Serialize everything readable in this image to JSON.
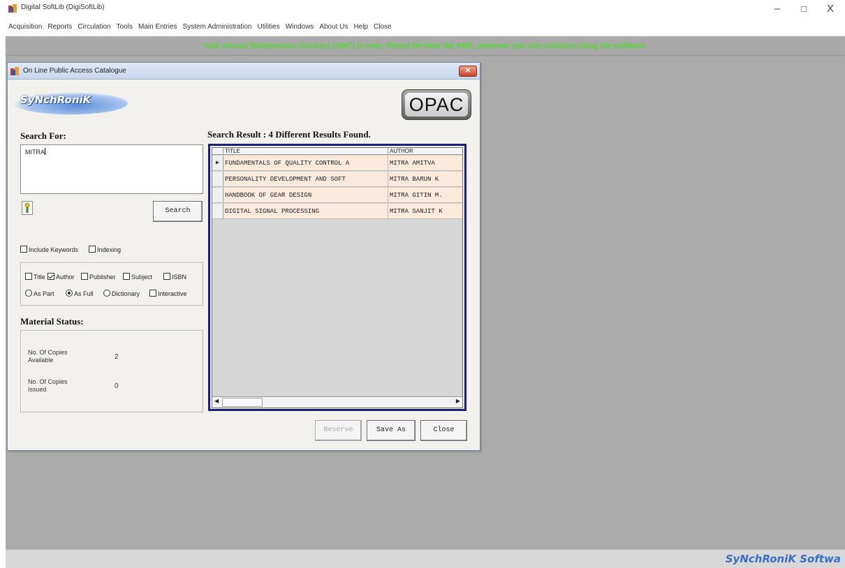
{
  "app": {
    "title": "Digital SoftLib (DigiSoftLib)",
    "window_controls": {
      "minimize": "–",
      "maximize": "□",
      "close": "X"
    }
  },
  "menu": [
    "Acquisition",
    "Reports",
    "Circulation",
    "Tools",
    "Main Entries",
    "System Administration",
    "Utilities",
    "Windows",
    "About Us",
    "Help",
    "Close"
  ],
  "notice": "Your Annual Maintenance Contract (AMC) is over. Please Re-New the AMC, However you can continue using the software.",
  "opac": {
    "window_title": "On Line Public Access Catalogue",
    "brand": "SyNchRoniK",
    "badge": "OPAC",
    "search_for_label": "Search For:",
    "search_value": "MITRA",
    "search_button": "Search",
    "include_keywords": "Include Keywords",
    "indexing": "Indexing",
    "fields": [
      {
        "label": "Title",
        "checked": false
      },
      {
        "label": "Author",
        "checked": true
      },
      {
        "label": "Publisher",
        "checked": false
      },
      {
        "label": "Subject",
        "checked": false
      },
      {
        "label": "ISBN",
        "checked": false
      }
    ],
    "match_modes": [
      {
        "label": "As Part",
        "selected": false
      },
      {
        "label": "As Full",
        "selected": true
      },
      {
        "label": "Dictionary",
        "selected": false
      }
    ],
    "interactive": "Interactive",
    "material_status_label": "Material Status:",
    "copies_available_label": "No. Of Copies Available",
    "copies_available": "2",
    "copies_issued_label": "No. Of Copies Issued",
    "copies_issued": "0",
    "result_title": "Search Result : 4  Different Results Found.",
    "grid": {
      "columns": [
        "TITLE",
        "AUTHOR"
      ],
      "rows": [
        {
          "title": "FUNDAMENTALS OF QUALITY CONTROL A",
          "author": "MITRA AMITVA"
        },
        {
          "title": "PERSONALITY DEVELOPMENT AND SOFT",
          "author": "MITRA BARUN K"
        },
        {
          "title": "HANDBOOK OF GEAR DESIGN",
          "author": "MITRA GITIN M."
        },
        {
          "title": "DIGITAL SIGNAL PROCESSING",
          "author": "MITRA SANJIT K"
        }
      ],
      "selected_row": 0
    },
    "buttons": {
      "reserve": "Reserve",
      "save_as": "Save As",
      "close": "Close"
    }
  },
  "statusbar": {
    "brand": "SyNchRoniK Softwa"
  },
  "colors": {
    "notice_text": "#4dde2a",
    "grid_frame": "#1c1e7a",
    "row_bg": "#fbe9dc",
    "mdi_bg": "#ababab"
  }
}
